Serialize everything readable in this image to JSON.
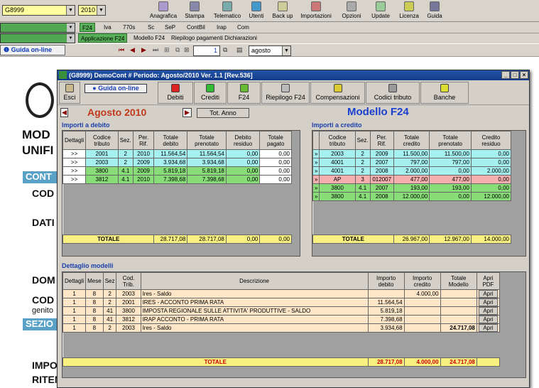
{
  "topbar": {
    "client_code": "G8999",
    "year": "2010",
    "buttons": [
      "Anagrafica",
      "Stampa",
      "Telematico",
      "Utenti",
      "Back up",
      "Importazioni",
      "Opzioni",
      "Update",
      "Licenza",
      "Guida"
    ]
  },
  "row2": {
    "tabs": [
      "F24",
      "Iva",
      "770s",
      "Sc",
      "SeP",
      "ContBil",
      "Irap",
      "Com"
    ]
  },
  "row3": {
    "items": [
      "Applicazione F24",
      "Modello F24",
      "Riepilogo pagamenti Dichiarazioni"
    ]
  },
  "row4": {
    "guide": "Guida on-line",
    "page": "1",
    "month": "agosto"
  },
  "background_doc": {
    "texts": [
      "MOD",
      "UNIFI",
      "CONT",
      "COD",
      "DATI",
      "DOM",
      "COD",
      "genito",
      "SEZIO",
      "IMPO",
      "RITEN"
    ]
  },
  "dialog": {
    "title": "(G8999) DemoCont  # Periodo: Agosto/2010 Ver. 1.1 [Rev.536]",
    "window_buttons": [
      "_",
      "□",
      "×"
    ],
    "toolbar": {
      "esci": "Esci",
      "guide": "Guida on-line",
      "buttons": [
        "Debiti",
        "Crediti",
        "F24",
        "Riepilogo F24",
        "Compensazioni",
        "Codici tributo",
        "Banche"
      ]
    },
    "period_label": "Agosto 2010",
    "tot_anno": "Tot. Anno",
    "model_title": "Modello F24",
    "debit": {
      "section_title": "Importi a debito",
      "headers": [
        "Dettagli",
        "Codice tributo",
        "Sez.",
        "Per. Rif.",
        "Totale debito",
        "Totale prenotato",
        "Debito residuo",
        "Totale pagato"
      ],
      "rows": [
        {
          "btn": ">>",
          "codice": "2001",
          "sez": "2",
          "per": "2010",
          "tot": "11.564,54",
          "pren": "11.564,54",
          "res": "0,00",
          "pag": "0,00",
          "color": "cy"
        },
        {
          "btn": ">>",
          "codice": "2003",
          "sez": "2",
          "per": "2009",
          "tot": "3.934,68",
          "pren": "3.934,68",
          "res": "0,00",
          "pag": "0,00",
          "color": "cy"
        },
        {
          "btn": ">>",
          "codice": "3800",
          "sez": "4.1",
          "per": "2009",
          "tot": "5.819,18",
          "pren": "5.819,18",
          "res": "0,00",
          "pag": "0,00",
          "color": "cg"
        },
        {
          "btn": ">>",
          "codice": "3812",
          "sez": "4.1",
          "per": "2010",
          "tot": "7.398,68",
          "pren": "7.398,68",
          "res": "0,00",
          "pag": "0,00",
          "color": "cg"
        }
      ],
      "total_label": "TOTALE",
      "totals": [
        "28.717,08",
        "28.717,08",
        "0,00",
        "0,00"
      ]
    },
    "credit": {
      "section_title": "Importi a credito",
      "headers": [
        "",
        "Codice tributo",
        "Sez.",
        "Per. Rif.",
        "Totale credito",
        "Totale prenotato",
        "Credito residuo"
      ],
      "rows": [
        {
          "btn": "»",
          "codice": "2003",
          "sez": "2",
          "per": "2009",
          "tot": "11.500,00",
          "pren": "11.500,00",
          "res": "0,00",
          "color": "cy"
        },
        {
          "btn": "»",
          "codice": "4001",
          "sez": "2",
          "per": "2007",
          "tot": "797,00",
          "pren": "797,00",
          "res": "0,00",
          "color": "cy"
        },
        {
          "btn": "»",
          "codice": "4001",
          "sez": "2",
          "per": "2008",
          "tot": "2.000,00",
          "pren": "0,00",
          "res": "2.000,00",
          "color": "cy"
        },
        {
          "btn": "»",
          "codice": "AP",
          "sez": "3",
          "per": "012007",
          "tot": "477,00",
          "pren": "477,00",
          "res": "0,00",
          "color": "cp"
        },
        {
          "btn": "»",
          "codice": "3800",
          "sez": "4.1",
          "per": "2007",
          "tot": "193,00",
          "pren": "193,00",
          "res": "0,00",
          "color": "cg"
        },
        {
          "btn": "»",
          "codice": "3800",
          "sez": "4.1",
          "per": "2008",
          "tot": "12.000,00",
          "pren": "0,00",
          "res": "12.000,00",
          "color": "cg"
        }
      ],
      "total_label": "TOTALE",
      "totals": [
        "26.967,00",
        "12.967,00",
        "14.000,00"
      ]
    },
    "models": {
      "section_title": "Dettaglio modelli",
      "headers": [
        "Dettagli",
        "Mese",
        "Sez",
        "Cod. Trib.",
        "Descrizione",
        "Importo debito",
        "Importo credito",
        "Totale Modello",
        "Apri PDF"
      ],
      "rows": [
        {
          "d": "1",
          "mese": "8",
          "sez": "2",
          "cod": "2003",
          "desc": "Ires - Saldo",
          "deb": "",
          "cred": "4.000,00",
          "tot": "",
          "apri": "Apri"
        },
        {
          "d": "1",
          "mese": "8",
          "sez": "2",
          "cod": "2001",
          "desc": "IRES - ACCONTO PRIMA RATA",
          "deb": "11.564,54",
          "cred": "",
          "tot": "",
          "apri": "Apri"
        },
        {
          "d": "1",
          "mese": "8",
          "sez": "41",
          "cod": "3800",
          "desc": "IMPOSTA REGIONALE SULLE ATTIVITA' PRODUTTIVE - SALDO",
          "deb": "5.819,18",
          "cred": "",
          "tot": "",
          "apri": "Apri"
        },
        {
          "d": "1",
          "mese": "8",
          "sez": "41",
          "cod": "3812",
          "desc": "IRAP ACCONTO - PRIMA RATA",
          "deb": "7.398,68",
          "cred": "",
          "tot": "",
          "apri": "Apri"
        },
        {
          "d": "1",
          "mese": "8",
          "sez": "2",
          "cod": "2003",
          "desc": "Ires - Saldo",
          "deb": "3.934,68",
          "cred": "",
          "tot": "24.717,08",
          "apri": "Apri"
        }
      ],
      "total_label": "TOTALE",
      "totals": [
        "28.717,08",
        "4.000,00",
        "24.717,08"
      ]
    }
  }
}
